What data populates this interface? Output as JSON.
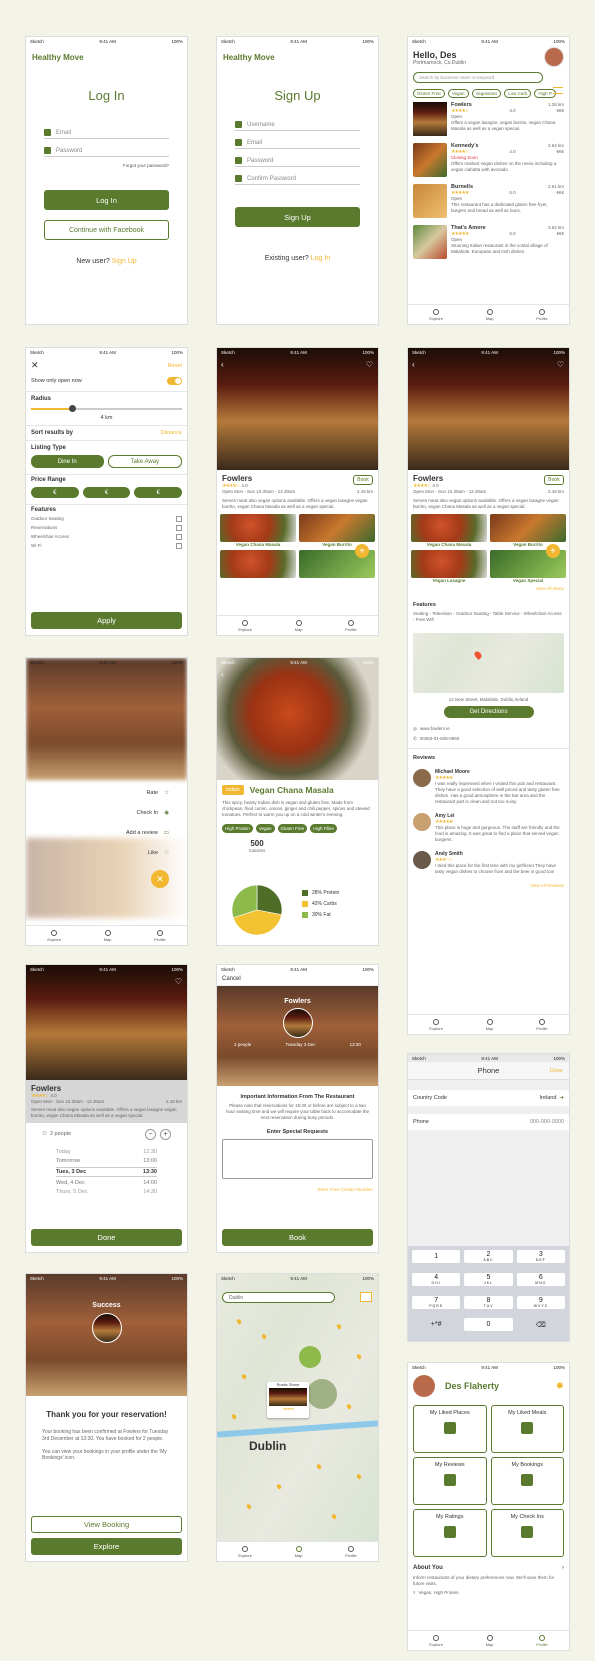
{
  "status": {
    "carrier": "Sketch",
    "time": "9:41 AM",
    "battery": "100%"
  },
  "login": {
    "logo": "Healthy Move",
    "title": "Log In",
    "email": "Email",
    "password": "Password",
    "forgot": "Forgot your password?",
    "login_btn": "Log In",
    "fb_btn": "Continue with Facebook",
    "new_user": "New user?",
    "signup_link": "Sign Up"
  },
  "signup": {
    "logo": "Healthy Move",
    "title": "Sign Up",
    "username": "Username",
    "email": "Email",
    "password": "Password",
    "confirm": "Confirm Password",
    "signup_btn": "Sign Up",
    "existing": "Existing user?",
    "login_link": "Log In"
  },
  "explore": {
    "greeting": "Hello, Des",
    "location": "Portmarnock, Co.Dublin",
    "search_placeholder": "Search by business name or keyword",
    "chips": [
      "Gluten Free",
      "Vegan",
      "Vegetarian",
      "Low Carb",
      "High P"
    ],
    "places": [
      {
        "name": "Fowlers",
        "rating": "4.0",
        "dist": "1.28 km",
        "status": "Open",
        "price": "€€€",
        "desc": "Offers a vegan lasagne, vegan burrito, vegan Chana Masala as well as a vegan special."
      },
      {
        "name": "Kennedy's",
        "rating": "4.0",
        "dist": "2.54 km",
        "status": "Closing Soon",
        "price": "€€€",
        "desc": "Offers marked vegan dishes on the menu including a vegan ciabatta with avocado."
      },
      {
        "name": "Burnells",
        "rating": "5.0",
        "dist": "2.61 km",
        "status": "Open",
        "price": "€€€",
        "desc": "This restaurant has a dedicated gluten free fryer, burgers and bread as well as buns."
      },
      {
        "name": "That's Amore",
        "rating": "5.0",
        "dist": "3.62 km",
        "status": "Open",
        "price": "€€€",
        "desc": "Stunning Italian restaurant in the costal village of Malahide. European and Irish dishes."
      }
    ]
  },
  "tabs": {
    "explore": "Explore",
    "map": "Map",
    "profile": "Profile"
  },
  "filter": {
    "reset": "Reset",
    "open_now": "Show only open now",
    "radius": "Radius",
    "radius_val": "4 km",
    "sort": "Sort results by",
    "sort_val": "Distance",
    "listing": "Listing Type",
    "dine": "Dine In",
    "take": "Take Away",
    "price": "Price Range",
    "euro": "€",
    "features": "Features",
    "feat_items": [
      "Outdoor Seating",
      "Reservations",
      "Wheelchair Access",
      "Wi-Fi"
    ],
    "apply": "Apply"
  },
  "fowlers": {
    "name": "Fowlers",
    "rating": "4.0",
    "book": "Book",
    "hours": "Open Mon - Sun 10.30am - 12.30am",
    "dist": "2.18 km",
    "desc": "Serves meat also vegan options available. Offers a vegan lasagne vegan burrito, vegan Chana Masala as well as a vegan special.",
    "dishes": [
      "Vegan Chana Masala",
      "Vegan Burrito",
      "Vegan Lasagne",
      "Vegan Special"
    ],
    "view_menu": "View All Menu",
    "features_title": "Features",
    "features": "Seating - Television - Outdoor Seating - Table Service - Wheelchair Access - Free Wifi",
    "address": "12 New Street, Malahide, Dublin,Ireland",
    "directions": "Get Directions",
    "web": "www.fowlers.ie",
    "phone": "00353-01-845-0960",
    "reviews_title": "Reviews",
    "reviews": [
      {
        "name": "Michael Moore",
        "text": "I was really impressed when I visited this pub and restaurant. They have a good selection of well priced and tasty gluten free dishes. Has a good atmosphere in the bar area and the restaurant part is clean and not too noisy."
      },
      {
        "name": "Amy Lei",
        "text": "This place is huge and gorgeous. The staff are friendly and the food is amazing. It was great to find a place that served vegan burgers!."
      },
      {
        "name": "Andy Smith",
        "text": "I tried this place for the first time with my girlfriend.They have tasty vegan dishes to choose from and the beer is good too!"
      }
    ],
    "view_reviews": "View All Reviews"
  },
  "actions": {
    "rate": "Rate",
    "checkin": "Check In",
    "review": "Add a review",
    "like": "Like"
  },
  "dish": {
    "tag": "Indian",
    "name": "Vegan Chana Masala",
    "desc": "This spicy, hearty Indian dish is vegan and gluten free. Made from chickpeas, fried cumin, onions, ginger and chili pepper, spices and stewed tomatoes. Perfect to warm you up on a cold winter's evening.",
    "tags": [
      "High Protein",
      "Vegan",
      "Gluten Free",
      "High Fibre"
    ],
    "cal": "500",
    "cal_label": "Calories",
    "legend": [
      "28% Protein",
      "42% Carbs",
      "30% Fat"
    ]
  },
  "chart_data": {
    "type": "pie",
    "categories": [
      "Protein",
      "Carbs",
      "Fat"
    ],
    "values": [
      28,
      42,
      30
    ],
    "colors": [
      "#4e6e27",
      "#f2c233",
      "#8dba4a"
    ]
  },
  "booking": {
    "people": "2 people",
    "dates": [
      "Today",
      "Tomorrow",
      "Tues, 3 Dec",
      "Wed, 4 Dec",
      "Thurs, 5 Dec"
    ],
    "times": [
      "12:30",
      "13:00",
      "13:30",
      "14:00",
      "14:30"
    ],
    "done": "Done"
  },
  "reserve": {
    "cancel": "Cancel",
    "name": "Fowlers",
    "people": "2 people",
    "date": "Tuesday 3 Dec",
    "time": "13:30",
    "info_title": "Important Information From The Restaurant",
    "info": "Please note that reservations for 19:30 or before are subject to a two hour seating time and we will require your table back to accomodate the next reservation during busy periods.",
    "special": "Enter Special Requests",
    "contact": "Enter Free Contact Number",
    "book": "Book"
  },
  "phone": {
    "title": "Phone",
    "done": "Done",
    "country_label": "Country Code",
    "country_val": "Ireland",
    "phone_label": "Phone",
    "phone_val": "000-000-0000",
    "keys": [
      [
        "1",
        ""
      ],
      [
        "2",
        "ABC"
      ],
      [
        "3",
        "DEF"
      ],
      [
        "4",
        "GHI"
      ],
      [
        "5",
        "JKL"
      ],
      [
        "6",
        "MNO"
      ],
      [
        "7",
        "PQRS"
      ],
      [
        "8",
        "TUV"
      ],
      [
        "9",
        "WXYZ"
      ],
      [
        "+*#",
        ""
      ],
      [
        "0",
        ""
      ],
      [
        "⌫",
        ""
      ]
    ]
  },
  "success": {
    "title": "Success",
    "heading": "Thank you for your reservation!",
    "p1": "Your booking has been confirmed at Fowlers for Tuesday 3rd December at 13:30. You have booked for 2 people.",
    "p2": "You can view your bookings in your profile under the 'My Bookings' icon.",
    "view": "View Booking",
    "explore": "Explore"
  },
  "mapscr": {
    "search": "Dublin",
    "city": "Dublin",
    "card": "Rustic Stone"
  },
  "profile": {
    "name": "Des Flaherty",
    "cards": [
      "My Liked Places",
      "My Liked Meals",
      "My Reviews",
      "My Bookings",
      "My Ratings",
      "My Check Ins"
    ],
    "about": "About You",
    "about_text": "Inform restaurants of your dietary preferences now. We'll save them for future visits.",
    "prefs": "Vegan, High Protein"
  }
}
